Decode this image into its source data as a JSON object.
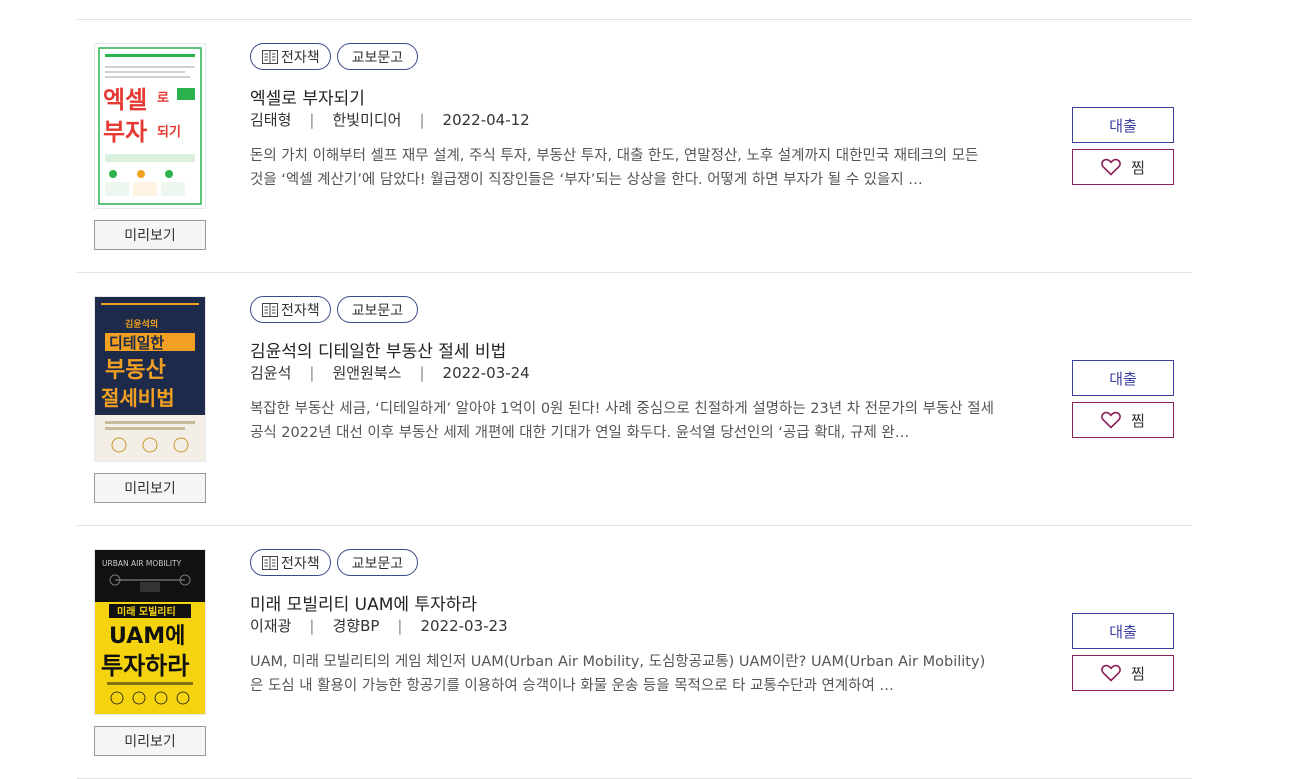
{
  "books": [
    {
      "tags": {
        "ebook": "전자책",
        "publisher_tag": "교보문고"
      },
      "title": "엑셀로 부자되기",
      "author": "김태형",
      "publisher": "한빛미디어",
      "date": "2022-04-12",
      "description": "돈의 가치 이해부터 셀프 재무 설계, 주식 투자, 부동산 투자, 대출 한도, 연말정산, 노후 설계까지 대한민국 재테크의 모든 것을 ‘엑셀 계산기’에 담았다! 월급쟁이 직장인들은 ‘부자’되는 상상을 한다. 어떻게 하면 부자가 될 수 있을지 …",
      "preview": "미리보기",
      "loan": "대출",
      "like": "찜",
      "cover": {
        "line1": "엑셀",
        "line1b": "로",
        "line2": "부자",
        "line2b": "되기",
        "color": "#e53a33",
        "accent": "#2bb24c"
      }
    },
    {
      "tags": {
        "ebook": "전자책",
        "publisher_tag": "교보문고"
      },
      "title": "김윤석의 디테일한 부동산 절세 비법",
      "author": "김윤석",
      "publisher": "원앤원북스",
      "date": "2022-03-24",
      "description": "복잡한 부동산 세금, ‘디테일하게’ 알아야 1억이 0원 된다! 사례 중심으로 친절하게 설명하는 23년 차 전문가의 부동산 절세 공식 2022년 대선 이후 부동산 세제 개편에 대한 기대가 연일 화두다. 윤석열 당선인의 ‘공급 확대, 규제 완…",
      "preview": "미리보기",
      "loan": "대출",
      "like": "찜",
      "cover": {
        "line0": "김윤석의",
        "line1": "디테일한",
        "line2": "부동산",
        "line3": "절세비법",
        "bg": "#1d2a4a",
        "accent": "#f2a022"
      }
    },
    {
      "tags": {
        "ebook": "전자책",
        "publisher_tag": "교보문고"
      },
      "title": "미래 모빌리티 UAM에 투자하라",
      "author": "이재광",
      "publisher": "경향BP",
      "date": "2022-03-23",
      "description": "UAM, 미래 모빌리티의 게임 체인저 UAM(Urban Air Mobility, 도심항공교통) UAM이란? UAM(Urban Air Mobility)은 도심 내 활용이 가능한 항공기를 이용하여 승객이나 화물 운송 등을 목적으로 타 교통수단과 연계하여 …",
      "preview": "미리보기",
      "loan": "대출",
      "like": "찜",
      "cover": {
        "top": "URBAN AIR MOBILITY",
        "line0": "미래 모빌리티",
        "line1": "UAM에",
        "line2": "투자하라",
        "bg": "#111111",
        "accent": "#f5d40f"
      }
    }
  ]
}
